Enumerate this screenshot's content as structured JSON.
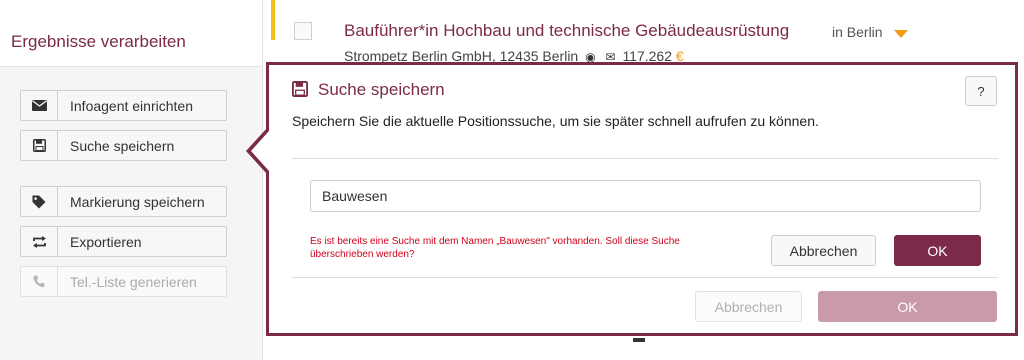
{
  "sidebar": {
    "title": "Ergebnisse verarbeiten",
    "buttons": [
      {
        "label": "Infoagent einrichten",
        "icon": "envelope-icon",
        "enabled": true
      },
      {
        "label": "Suche speichern",
        "icon": "floppy-disk-icon",
        "enabled": true
      },
      {
        "label": "Markierung speichern",
        "icon": "tag-icon",
        "enabled": true
      },
      {
        "label": "Exportieren",
        "icon": "export-arrows-icon",
        "enabled": true
      },
      {
        "label": "Tel.-Liste generieren",
        "icon": "phone-icon",
        "enabled": false
      }
    ]
  },
  "result": {
    "title": "Bauführer*in Hochbau und technische Gebäudeausrüstung",
    "location": "in Berlin",
    "company": "Strompetz Berlin GmbH, 12435 Berlin",
    "amount": "117.262",
    "currency": "€"
  },
  "dialog": {
    "title": "Suche speichern",
    "help_label": "?",
    "description": "Speichern Sie die aktuelle Positionssuche, um sie später schnell aufrufen zu können.",
    "input_value": "Bauwesen",
    "error": "Es ist bereits eine Suche mit dem Namen „Bauwesen\" vorhanden. Soll diese Suche überschrieben werden?",
    "confirm_cancel": "Abbrechen",
    "confirm_ok": "OK",
    "cancel": "Abbrechen",
    "ok": "OK"
  },
  "colors": {
    "brand": "#7b2a49",
    "brand_disabled": "#c99aab",
    "accent": "#f39c12",
    "error": "#d0021b",
    "highlight": "#f2c01e"
  }
}
